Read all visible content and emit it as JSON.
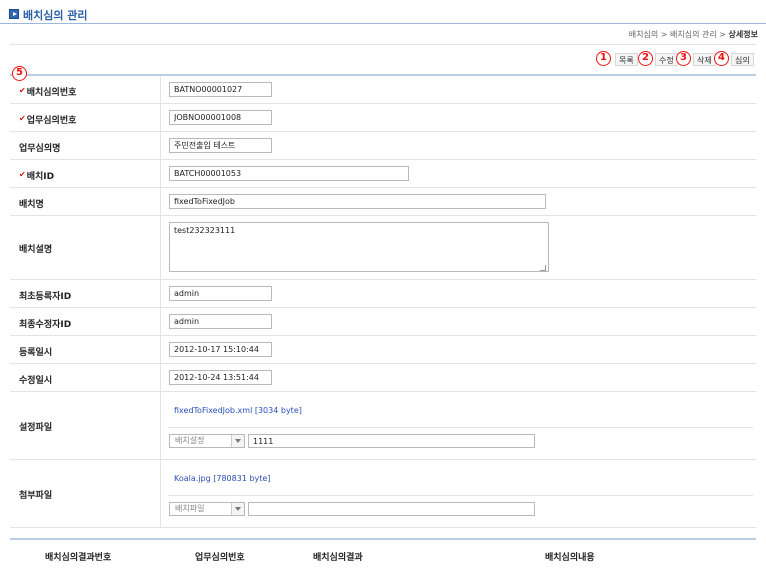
{
  "page": {
    "title": "배치심의 관리"
  },
  "breadcrumb": {
    "items": [
      "배치심의",
      "배치심의 관리"
    ],
    "separator": ">",
    "current": "상세정보"
  },
  "actions": [
    {
      "marker": "1",
      "label": "목록"
    },
    {
      "marker": "2",
      "label": "수정"
    },
    {
      "marker": "3",
      "label": "삭제"
    },
    {
      "marker": "4",
      "label": "심의"
    }
  ],
  "marker5": "5",
  "required_mark": "✔",
  "form": {
    "batch_review_no": {
      "label": "배치심의번호",
      "value": "BATNO00001027",
      "required": true
    },
    "job_review_no": {
      "label": "업무심의번호",
      "value": "JOBNO00001008",
      "required": true
    },
    "job_review_name": {
      "label": "업무심의명",
      "value": "주민전출입 테스트",
      "required": false
    },
    "batch_id": {
      "label": "배치ID",
      "value": "BATCH00001053",
      "required": true
    },
    "batch_name": {
      "label": "배치명",
      "value": "fixedToFixedJob",
      "required": false
    },
    "batch_description": {
      "label": "배치설명",
      "value": "test232323111",
      "required": false
    },
    "first_registrant_id": {
      "label": "최초등록자ID",
      "value": "admin",
      "required": false
    },
    "last_modifier_id": {
      "label": "최종수정자ID",
      "value": "admin",
      "required": false
    },
    "registered_at": {
      "label": "등록일시",
      "value": "2012-10-17 15:10:44",
      "required": false
    },
    "modified_at": {
      "label": "수정일시",
      "value": "2012-10-24 13:51:44",
      "required": false
    },
    "config_file": {
      "label": "설정파일",
      "link": "fixedToFixedJob.xml [3034 byte]",
      "select_value": "배치설정",
      "input_value": "1111"
    },
    "attachment_file": {
      "label": "첨부파일",
      "link": "Koala.jpg [780831 byte]",
      "select_value": "배치파일",
      "input_value": ""
    }
  },
  "result_table": {
    "columns": [
      "배치심의결과번호",
      "업무심의번호",
      "배치심의결과",
      "배치심의내용"
    ]
  },
  "colors": {
    "accent": "#2b5fa8",
    "marker": "#ee1111",
    "required": "#dd1111",
    "link": "#2b4fb8"
  }
}
